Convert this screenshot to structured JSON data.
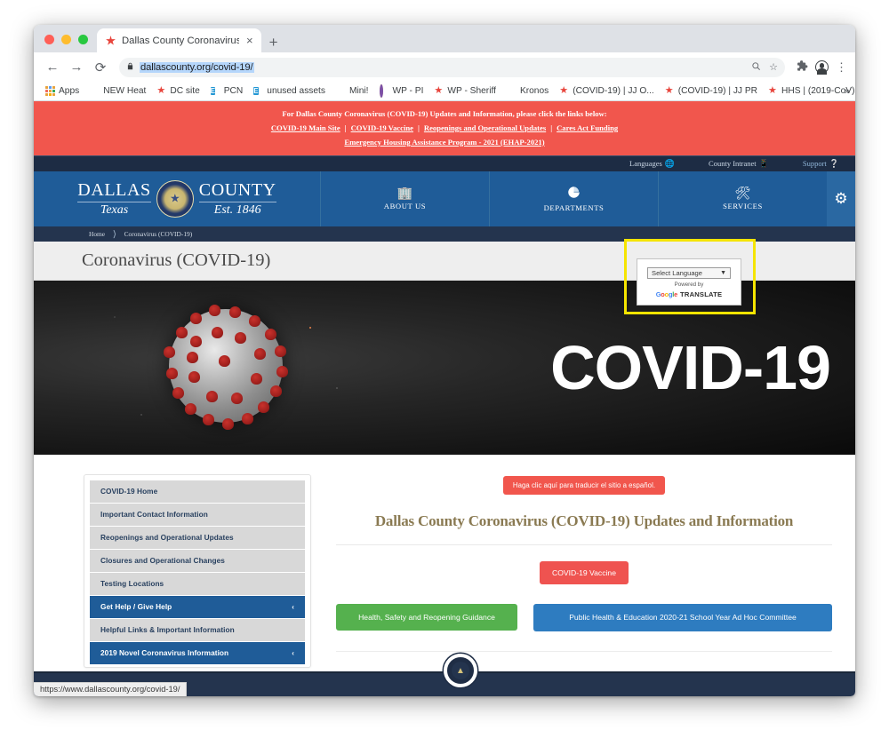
{
  "browser": {
    "tab": {
      "title": "Dallas County Coronavirus (CO",
      "favicon": "red-star-icon",
      "close_label": "×"
    },
    "new_tab_label": "+",
    "nav": {
      "back": "←",
      "forward": "→",
      "reload": "⟳"
    },
    "omnibox": {
      "lock_icon": "lock-icon",
      "url": "dallascounty.org/covid-19/",
      "search_icon": "🔍",
      "bookmark_icon": "☆"
    },
    "toolbar_right": {
      "extensions_icon": "puzzle-icon",
      "profile_icon": "avatar-icon",
      "menu_icon": "⋮"
    },
    "bookmarks": [
      {
        "label": "Apps",
        "icon": "apps-grid-icon"
      },
      {
        "label": "NEW Heat",
        "icon": "red-square-icon"
      },
      {
        "label": "DC site",
        "icon": "red-star-icon"
      },
      {
        "label": "PCN",
        "icon": "blue-e-icon"
      },
      {
        "label": "unused assets",
        "icon": "blue-e-icon"
      },
      {
        "label": "Mini!",
        "icon": "globe-icon"
      },
      {
        "label": "WP - PI",
        "icon": "purple-circle-icon"
      },
      {
        "label": "WP - Sheriff",
        "icon": "red-star-icon"
      },
      {
        "label": "Kronos",
        "icon": "orange-circle-icon"
      },
      {
        "label": "(COVID-19) | JJ O...",
        "icon": "red-star-icon"
      },
      {
        "label": "(COVID-19) | JJ PR",
        "icon": "red-star-icon"
      },
      {
        "label": "HHS | (2019-CoV)",
        "icon": "red-star-icon"
      }
    ],
    "bookmarks_overflow": "»",
    "status_url": "https://www.dallascounty.org/covid-19/"
  },
  "alert": {
    "headline": "For Dallas County Coronavirus (COVID-19) Updates and Information, please click the links below:",
    "links": [
      "COVID-19 Main Site",
      "COVID-19 Vaccine",
      "Reopenings and Operational Updates",
      "Cares Act Funding"
    ],
    "separator": "|",
    "second_line": "Emergency Housing Assistance Program - 2021 (EHAP-2021)",
    "bg_color": "#f1564d"
  },
  "utilnav": [
    {
      "label": "Languages",
      "icon": "globe-icon"
    },
    {
      "label": "County Intranet",
      "icon": "mobile-icon"
    },
    {
      "label": "Support",
      "icon": "question-circle-icon"
    }
  ],
  "mainnav": {
    "logo": {
      "line1_left": "DALLAS",
      "line1_right": "COUNTY",
      "line2_left": "Texas",
      "line2_right": "Est. 1846",
      "seal": "dallas-county-seal"
    },
    "items": [
      {
        "label": "ABOUT US",
        "icon": "building-icon"
      },
      {
        "label": "DEPARTMENTS",
        "icon": "pie-chart-icon"
      },
      {
        "label": "SERVICES",
        "icon": "tools-icon"
      }
    ],
    "gear_icon": "gear-icon",
    "bg_color": "#1f5c98"
  },
  "translate_popup": {
    "select_value": "Select Language",
    "chevron": "⌄",
    "powered_by": "Powered by",
    "google_letters": [
      "G",
      "o",
      "o",
      "g",
      "l",
      "e"
    ],
    "translate_word": "TRANSLATE",
    "highlight_color": "#f5e400"
  },
  "breadcrumb": {
    "items": [
      "Home",
      "Coronavirus (COVID-19)"
    ],
    "separator": "❯"
  },
  "page": {
    "title": "Coronavirus (COVID-19)",
    "hero_text": "COVID-19"
  },
  "sidebar": {
    "items": [
      {
        "label": "COVID-19 Home",
        "active": false,
        "chevron": ""
      },
      {
        "label": "Important Contact Information",
        "active": false,
        "chevron": ""
      },
      {
        "label": "Reopenings and Operational Updates",
        "active": false,
        "chevron": ""
      },
      {
        "label": "Closures and Operational Changes",
        "active": false,
        "chevron": ""
      },
      {
        "label": "Testing Locations",
        "active": false,
        "chevron": ""
      },
      {
        "label": "Get Help / Give Help",
        "active": true,
        "chevron": "‹"
      },
      {
        "label": "Helpful Links & Important Information",
        "active": false,
        "chevron": ""
      },
      {
        "label": "2019 Novel Coronavirus Information",
        "active": true,
        "chevron": "‹"
      }
    ]
  },
  "main": {
    "spanish_button": "Haga clic aquí para traducir el sitio a español.",
    "heading": "Dallas County Coronavirus (COVID-19) Updates and Information",
    "vaccine_button": "COVID-19 Vaccine",
    "green_button": "Health, Safety and Reopening Guidance",
    "blue_button": "Public Health & Education 2020-21 School Year Ad Hoc Committee"
  },
  "footer": {
    "scroll_top_icon": "scroll-to-top-badge"
  }
}
